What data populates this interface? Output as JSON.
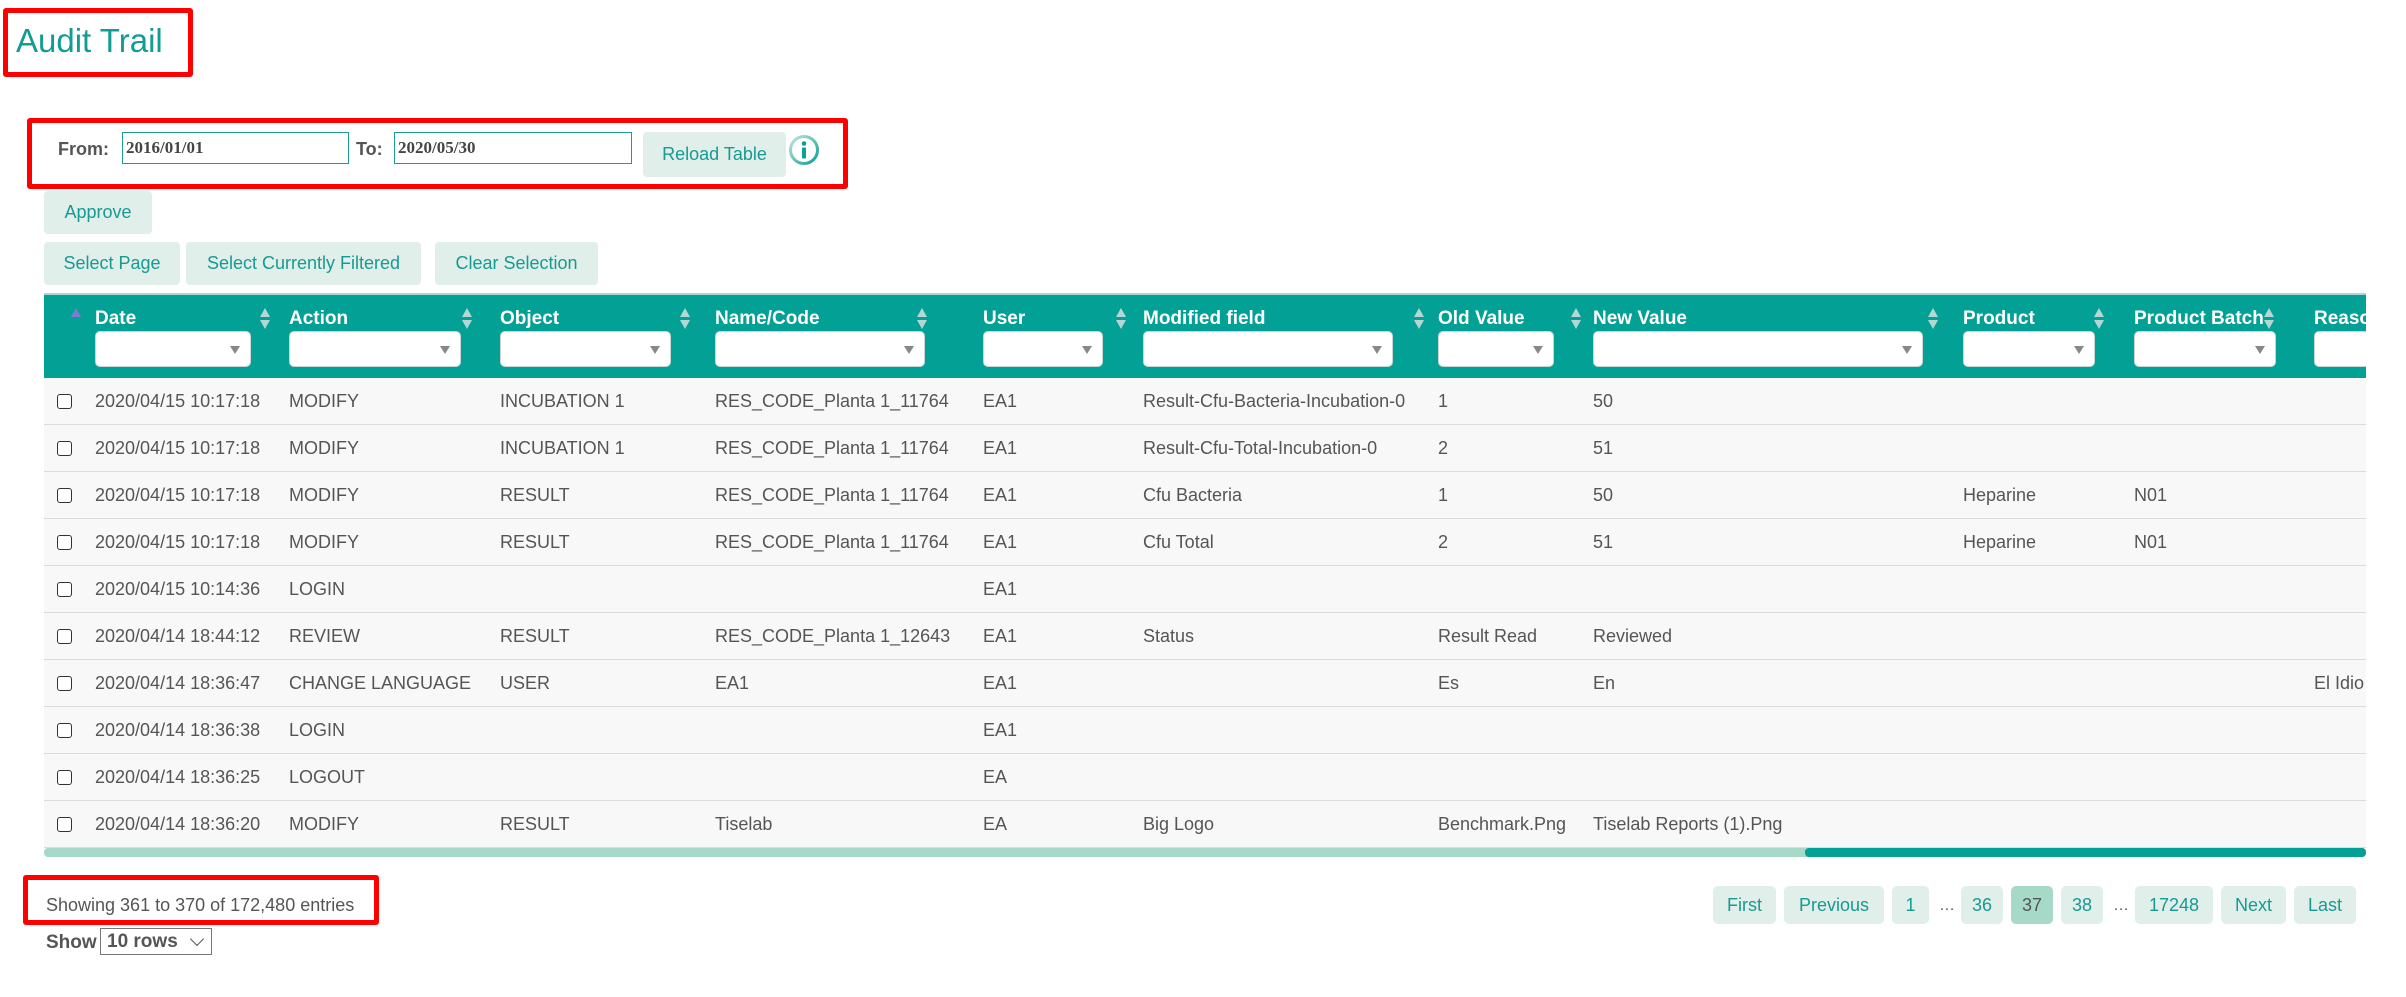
{
  "page": {
    "title": "Audit Trail"
  },
  "filter": {
    "from_label": "From:",
    "from_value": "2016/01/01",
    "to_label": "To:",
    "to_value": "2020/05/30",
    "reload_label": "Reload Table",
    "info_icon": "info-circle-icon"
  },
  "actions": {
    "approve_label": "Approve",
    "select_page_label": "Select Page",
    "select_filtered_label": "Select Currently Filtered",
    "clear_selection_label": "Clear Selection"
  },
  "table": {
    "columns": [
      {
        "key": "date",
        "label": "Date",
        "sorted": "asc"
      },
      {
        "key": "action",
        "label": "Action"
      },
      {
        "key": "object",
        "label": "Object"
      },
      {
        "key": "name_code",
        "label": "Name/Code"
      },
      {
        "key": "user",
        "label": "User"
      },
      {
        "key": "modified_field",
        "label": "Modified field"
      },
      {
        "key": "old_value",
        "label": "Old Value"
      },
      {
        "key": "new_value",
        "label": "New Value"
      },
      {
        "key": "product",
        "label": "Product"
      },
      {
        "key": "product_batch",
        "label": "Product Batch"
      },
      {
        "key": "reason",
        "label": "Reaso"
      }
    ],
    "rows": [
      {
        "date": "2020/04/15 10:17:18",
        "action": "MODIFY",
        "object": "INCUBATION 1",
        "name_code": "RES_CODE_Planta 1_11764",
        "user": "EA1",
        "modified_field": "Result-Cfu-Bacteria-Incubation-0",
        "old_value": "1",
        "new_value": "50",
        "product": "",
        "product_batch": "",
        "reason": "",
        "checked": false
      },
      {
        "date": "2020/04/15 10:17:18",
        "action": "MODIFY",
        "object": "INCUBATION 1",
        "name_code": "RES_CODE_Planta 1_11764",
        "user": "EA1",
        "modified_field": "Result-Cfu-Total-Incubation-0",
        "old_value": "2",
        "new_value": "51",
        "product": "",
        "product_batch": "",
        "reason": "",
        "checked": false
      },
      {
        "date": "2020/04/15 10:17:18",
        "action": "MODIFY",
        "object": "RESULT",
        "name_code": "RES_CODE_Planta 1_11764",
        "user": "EA1",
        "modified_field": "Cfu Bacteria",
        "old_value": "1",
        "new_value": "50",
        "product": "Heparine",
        "product_batch": "N01",
        "reason": "",
        "checked": false
      },
      {
        "date": "2020/04/15 10:17:18",
        "action": "MODIFY",
        "object": "RESULT",
        "name_code": "RES_CODE_Planta 1_11764",
        "user": "EA1",
        "modified_field": "Cfu Total",
        "old_value": "2",
        "new_value": "51",
        "product": "Heparine",
        "product_batch": "N01",
        "reason": "",
        "checked": false
      },
      {
        "date": "2020/04/15 10:14:36",
        "action": "LOGIN",
        "object": "",
        "name_code": "",
        "user": "EA1",
        "modified_field": "",
        "old_value": "",
        "new_value": "",
        "product": "",
        "product_batch": "",
        "reason": "",
        "checked": false
      },
      {
        "date": "2020/04/14 18:44:12",
        "action": "REVIEW",
        "object": "RESULT",
        "name_code": "RES_CODE_Planta 1_12643",
        "user": "EA1",
        "modified_field": "Status",
        "old_value": "Result Read",
        "new_value": "Reviewed",
        "product": "",
        "product_batch": "",
        "reason": "",
        "checked": false
      },
      {
        "date": "2020/04/14 18:36:47",
        "action": "CHANGE LANGUAGE",
        "object": "USER",
        "name_code": "EA1",
        "user": "EA1",
        "modified_field": "",
        "old_value": "Es",
        "new_value": "En",
        "product": "",
        "product_batch": "",
        "reason": "El Idio",
        "checked": false
      },
      {
        "date": "2020/04/14 18:36:38",
        "action": "LOGIN",
        "object": "",
        "name_code": "",
        "user": "EA1",
        "modified_field": "",
        "old_value": "",
        "new_value": "",
        "product": "",
        "product_batch": "",
        "reason": "",
        "checked": false
      },
      {
        "date": "2020/04/14 18:36:25",
        "action": "LOGOUT",
        "object": "",
        "name_code": "",
        "user": "EA",
        "modified_field": "",
        "old_value": "",
        "new_value": "",
        "product": "",
        "product_batch": "",
        "reason": "",
        "checked": false
      },
      {
        "date": "2020/04/14 18:36:20",
        "action": "MODIFY",
        "object": "RESULT",
        "name_code": "Tiselab",
        "user": "EA",
        "modified_field": "Big Logo",
        "old_value": "Benchmark.Png",
        "new_value": "Tiselab Reports (1).Png",
        "product": "",
        "product_batch": "",
        "reason": "",
        "checked": false
      }
    ],
    "horizontal_scroll_fraction": 0.76
  },
  "footer": {
    "info_text": "Showing 361 to 370 of 172,480 entries",
    "show_label": "Show",
    "rows_per_page": "10 rows"
  },
  "pagination": {
    "items": [
      {
        "label": "First",
        "type": "nav"
      },
      {
        "label": "Previous",
        "type": "nav"
      },
      {
        "label": "1",
        "type": "page"
      },
      {
        "label": "…",
        "type": "ellipsis"
      },
      {
        "label": "36",
        "type": "page"
      },
      {
        "label": "37",
        "type": "page",
        "current": true
      },
      {
        "label": "38",
        "type": "page"
      },
      {
        "label": "…",
        "type": "ellipsis"
      },
      {
        "label": "17248",
        "type": "page"
      },
      {
        "label": "Next",
        "type": "nav"
      },
      {
        "label": "Last",
        "type": "nav"
      }
    ]
  },
  "colors": {
    "accent": "#03a096",
    "button_bg": "#e0efe9",
    "current_page_bg": "#a6d9c8",
    "highlight_box": "#ff0000"
  }
}
